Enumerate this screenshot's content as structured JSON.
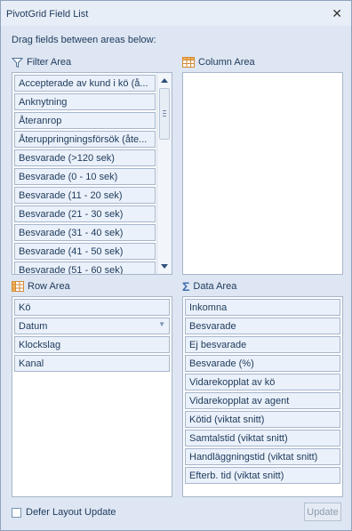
{
  "window": {
    "title": "PivotGrid Field List"
  },
  "hint": "Drag fields between areas below:",
  "filter_area": {
    "label": "Filter Area",
    "icon": "filter-icon",
    "fields": [
      "Accepterade av kund i kö (å...",
      "Anknytning",
      "Återanrop",
      "Återuppringningsförsök (åte...",
      "Besvarade (>120 sek)",
      "Besvarade (0 - 10 sek)",
      "Besvarade (11 - 20 sek)",
      "Besvarade (21 - 30 sek)",
      "Besvarade (31 - 40 sek)",
      "Besvarade (41 - 50 sek)",
      "Besvarade (51 - 60 sek)"
    ]
  },
  "column_area": {
    "label": "Column Area",
    "icon": "table-icon",
    "fields": []
  },
  "row_area": {
    "label": "Row Area",
    "icon": "table-icon",
    "fields": [
      "Kö",
      "Datum",
      "Klockslag",
      "Kanal"
    ]
  },
  "data_area": {
    "label": "Data Area",
    "icon": "sigma-icon",
    "fields": [
      "Inkomna",
      "Besvarade",
      "Ej besvarade",
      "Besvarade (%)",
      "Vidarekopplat av kö",
      "Vidarekopplat av agent",
      "Kötid (viktat snitt)",
      "Samtalstid (viktat snitt)",
      "Handläggningstid (viktat snitt)",
      "Efterb. tid (viktat snitt)"
    ]
  },
  "footer": {
    "defer_label": "Defer Layout Update",
    "defer_checked": false,
    "update_label": "Update"
  }
}
